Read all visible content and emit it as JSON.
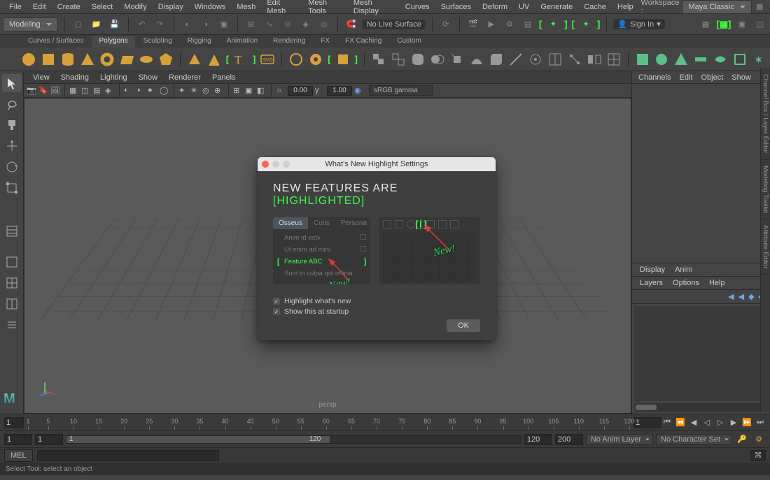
{
  "menu": {
    "items": [
      "File",
      "Edit",
      "Create",
      "Select",
      "Modify",
      "Display",
      "Windows",
      "Mesh",
      "Edit Mesh",
      "Mesh Tools",
      "Mesh Display",
      "Curves",
      "Surfaces",
      "Deform",
      "UV",
      "Generate",
      "Cache",
      "Help"
    ],
    "workspace_label": "Workspace :",
    "workspace_value": "Maya Classic"
  },
  "toolbar": {
    "mode": "Modeling",
    "no_live_surface": "No Live Surface",
    "sign_in": "Sign In"
  },
  "shelf_tabs": [
    "Curves / Surfaces",
    "Polygons",
    "Sculpting",
    "Rigging",
    "Animation",
    "Rendering",
    "FX",
    "FX Caching",
    "Custom"
  ],
  "shelf_active": "Polygons",
  "viewport": {
    "menu": [
      "View",
      "Shading",
      "Lighting",
      "Show",
      "Renderer",
      "Panels"
    ],
    "exposure": "0.00",
    "gamma": "1.00",
    "color_space": "sRGB gamma",
    "label": "persp"
  },
  "right_panel": {
    "tabs": [
      "Channels",
      "Edit",
      "Object",
      "Show"
    ],
    "layer_tabs": [
      "Display",
      "Anim"
    ],
    "layer_menu": [
      "Layers",
      "Options",
      "Help"
    ]
  },
  "side_tabs": [
    "Channel Box / Layer Editor",
    "Modeling Toolkit",
    "Attribute Editor"
  ],
  "time_slider": {
    "current": "1",
    "end_input": "1",
    "ticks": [
      1,
      5,
      10,
      15,
      20,
      25,
      30,
      35,
      40,
      45,
      50,
      55,
      60,
      65,
      70,
      75,
      80,
      85,
      90,
      95,
      100,
      105,
      110,
      115,
      120
    ]
  },
  "range_row": {
    "start_outer": "1",
    "start_inner": "1",
    "slider_left": "1",
    "slider_right": "120",
    "end_inner": "120",
    "end_outer": "200",
    "anim_layer": "No Anim Layer",
    "char_set": "No Character Set"
  },
  "mel": {
    "label": "MEL"
  },
  "status_bar": {
    "text": "Select Tool: select an object"
  },
  "logo": "M",
  "dialog": {
    "title": "What's New Highlight Settings",
    "headline_pre": "NEW  FEATURES  ARE ",
    "headline_hl": "[HIGHLIGHTED]",
    "left": {
      "tabs": [
        "Osseus",
        "Cutis",
        "Persona"
      ],
      "items": [
        {
          "label": "Anim id estv",
          "hl": false,
          "cb": true
        },
        {
          "label": "Ut enim ad mini",
          "hl": false,
          "cb": true
        },
        {
          "label": "Feature ABC",
          "hl": true,
          "cb": false
        },
        {
          "label": "Sunt in culpa qui officia",
          "hl": false,
          "cb": false
        }
      ]
    },
    "checks": {
      "hl_new": "Highlight what's new",
      "show_startup": "Show this at startup"
    },
    "ok": "OK",
    "new_label": "New!"
  }
}
